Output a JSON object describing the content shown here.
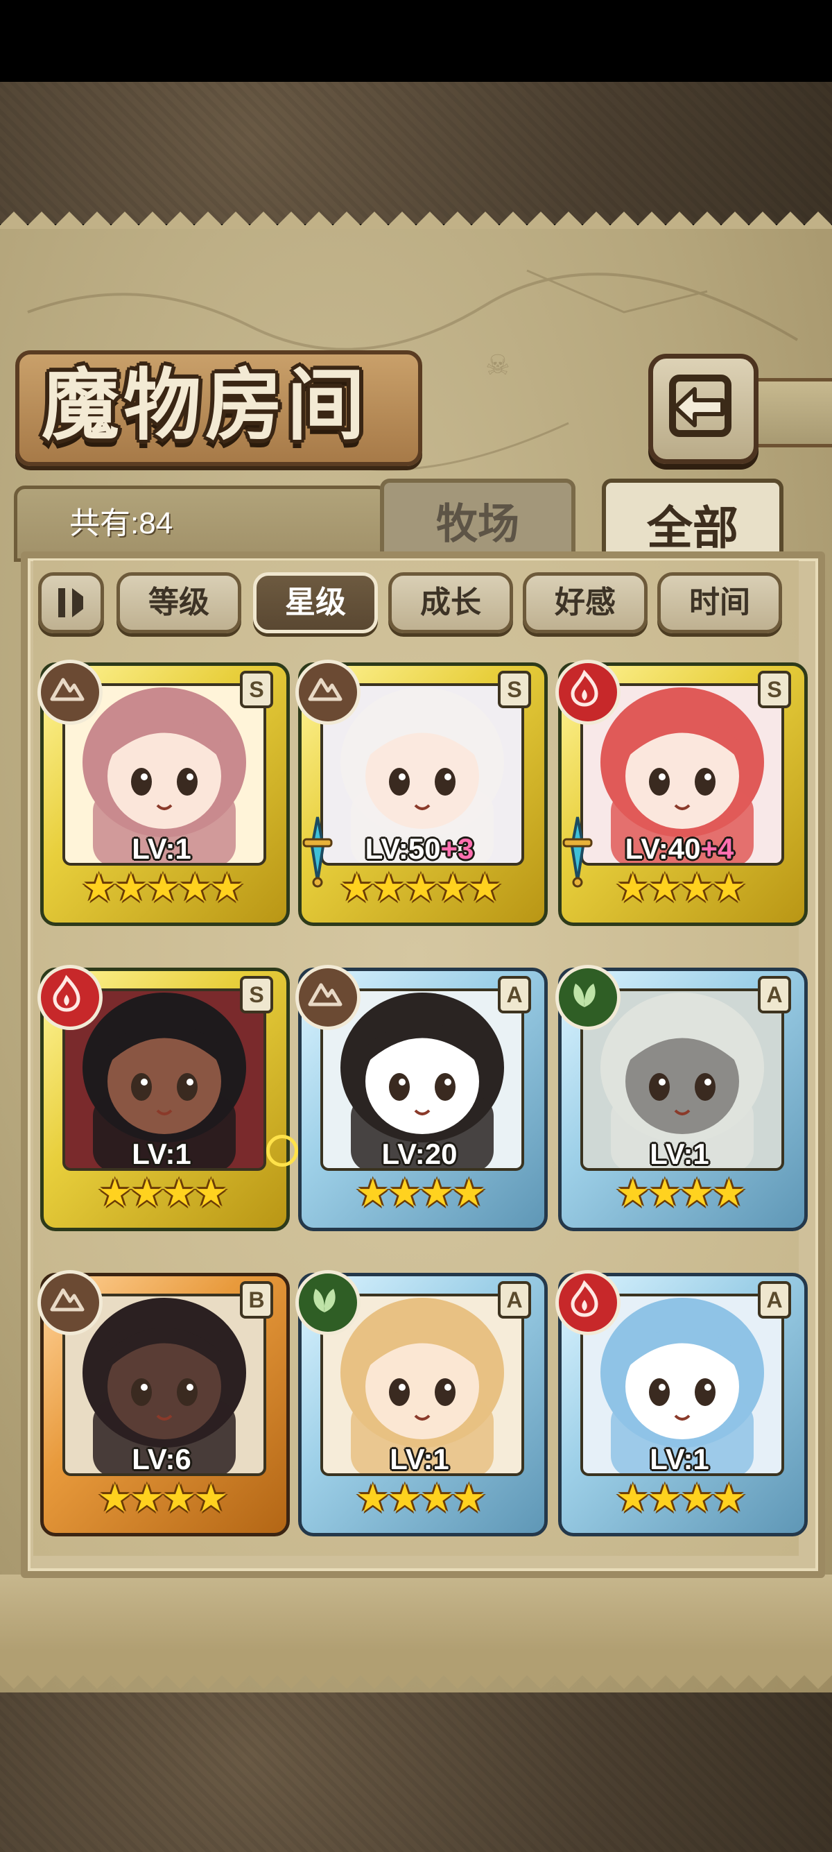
{
  "header": {
    "title": "魔物房间",
    "back_icon": "return-arrow-icon"
  },
  "tabs": [
    {
      "label": "牧场",
      "active": false
    },
    {
      "label": "全部",
      "active": true
    }
  ],
  "count_label": "共有:84",
  "sort": {
    "toggle_icon": "sort-order-icon",
    "buttons": [
      {
        "label": "等级",
        "active": false
      },
      {
        "label": "星级",
        "active": true
      },
      {
        "label": "成长",
        "active": false
      },
      {
        "label": "好感",
        "active": false
      },
      {
        "label": "时间",
        "active": false
      }
    ]
  },
  "monsters": [
    {
      "rank": "S",
      "element": "earth",
      "level": "LV:1",
      "bonus": "",
      "stars": "★★★★★",
      "equipped": false,
      "hair": "#c98a8e",
      "skin": "#fbe6da",
      "bg": "#fff4d9"
    },
    {
      "rank": "S",
      "element": "earth",
      "level": "LV:50",
      "bonus": "+3",
      "stars": "★★★★★",
      "equipped": true,
      "hair": "#f4f1f0",
      "skin": "#fbe9df",
      "bg": "#f1eef2"
    },
    {
      "rank": "S",
      "element": "fire",
      "level": "LV:40",
      "bonus": "+4",
      "stars": "★★★★",
      "equipped": true,
      "hair": "#e05a58",
      "skin": "#fbe7dd",
      "bg": "#f8e8e8"
    },
    {
      "rank": "S",
      "element": "fire",
      "level": "LV:1",
      "bonus": "",
      "stars": "★★★★",
      "equipped": false,
      "hair": "#1e1a1c",
      "skin": "#8a5643",
      "bg": "#7a2a2c"
    },
    {
      "rank": "A",
      "element": "earth",
      "level": "LV:20",
      "bonus": "",
      "stars": "★★★★",
      "equipped": false,
      "hair": "#2a2422",
      "skin": "#ffffff",
      "bg": "#eaf2f5"
    },
    {
      "rank": "A",
      "element": "leaf",
      "level": "LV:1",
      "bonus": "",
      "stars": "★★★★",
      "equipped": false,
      "hair": "#dfe3dd",
      "skin": "#8c8b88",
      "bg": "#cfd8d5"
    },
    {
      "rank": "B",
      "element": "earth",
      "level": "LV:6",
      "bonus": "",
      "stars": "★★★★",
      "equipped": false,
      "hair": "#2b2021",
      "skin": "#5a3d35",
      "bg": "#e9dcc4"
    },
    {
      "rank": "A",
      "element": "leaf",
      "level": "LV:1",
      "bonus": "",
      "stars": "★★★★",
      "equipped": false,
      "hair": "#e8c183",
      "skin": "#fbe7d3",
      "bg": "#f6ecd9"
    },
    {
      "rank": "A",
      "element": "fire",
      "level": "LV:1",
      "bonus": "",
      "stars": "★★★★",
      "equipped": false,
      "hair": "#8fc3e6",
      "skin": "#ffffff",
      "bg": "#e6f0f8"
    }
  ]
}
